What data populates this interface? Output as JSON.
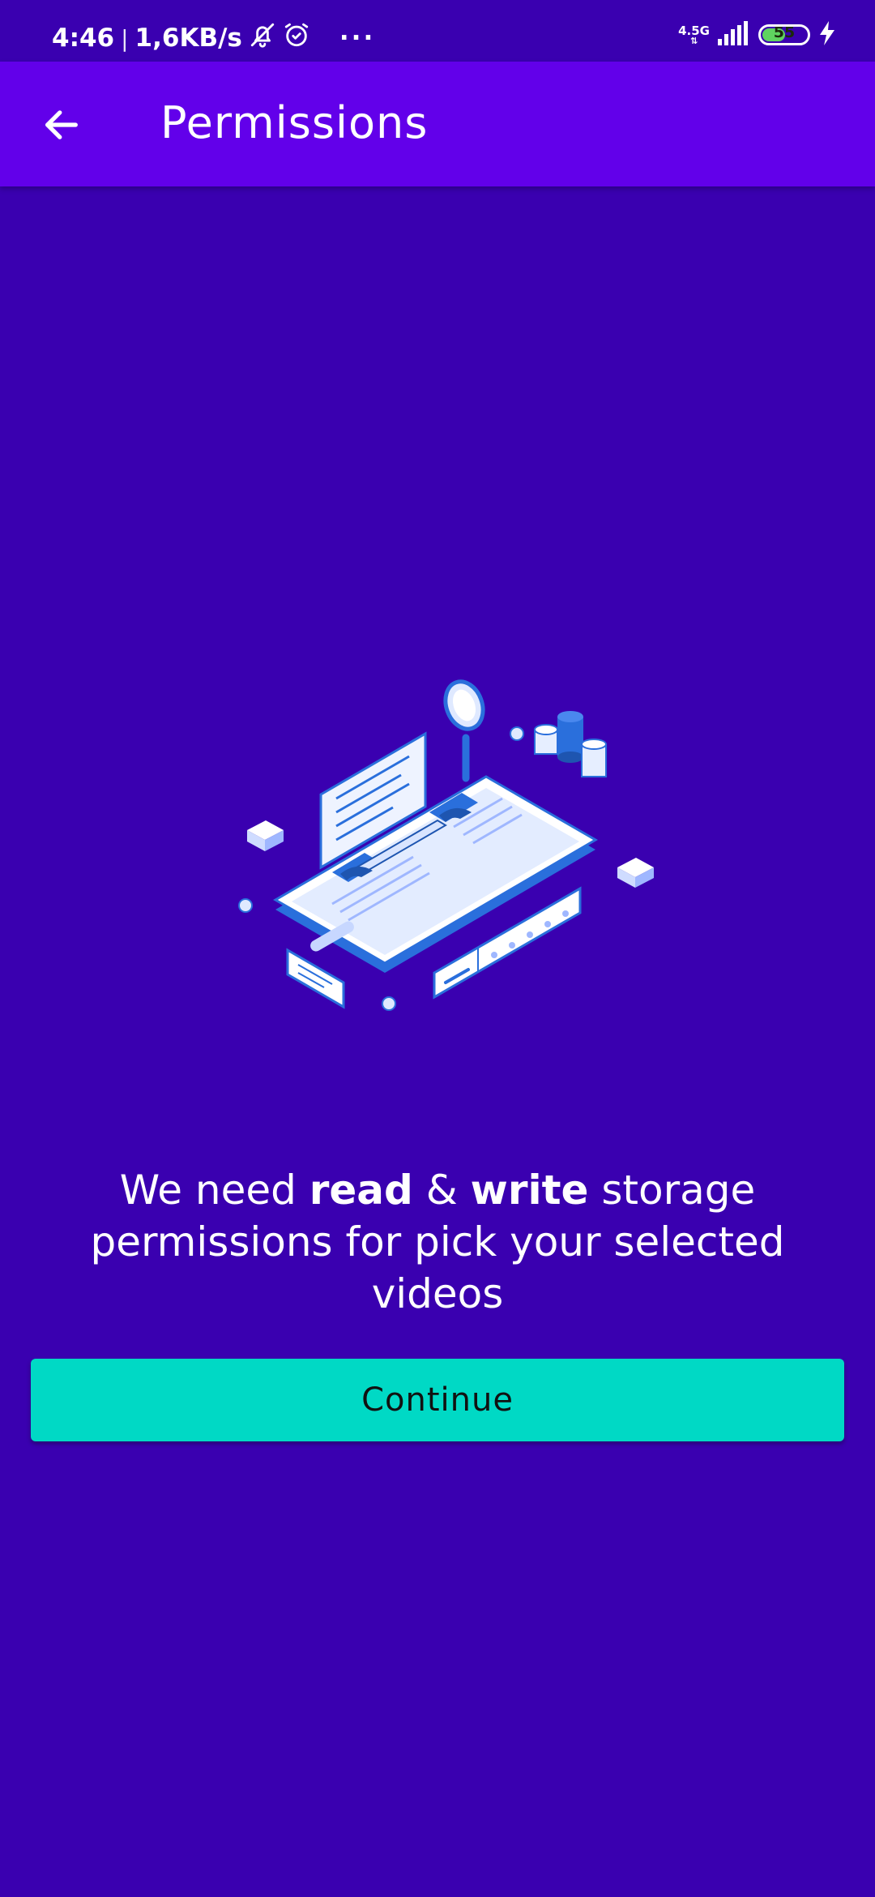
{
  "status_bar": {
    "time": "4:46",
    "separator": "|",
    "speed": "1,6KB/s",
    "more": "···",
    "network": "4.5G",
    "battery_level": 55,
    "battery_text": "55",
    "icons": [
      "bell-off-icon",
      "alarm-icon",
      "signal-icon",
      "battery-icon",
      "charging-icon"
    ]
  },
  "app_bar": {
    "title": "Permissions",
    "back_icon": "arrow-left-icon"
  },
  "illustration": {
    "icon": "phone-maintenance-illustration"
  },
  "message": {
    "part1": "We need ",
    "read": "read",
    "part2": " & ",
    "write": "write",
    "part3": " storage permissions for pick your selected videos"
  },
  "actions": {
    "continue_label": "Continue"
  },
  "colors": {
    "background": "#3a00b0",
    "app_bar": "#6200ea",
    "accent": "#00d9c5",
    "illustration_blue": "#2a6fdc"
  }
}
